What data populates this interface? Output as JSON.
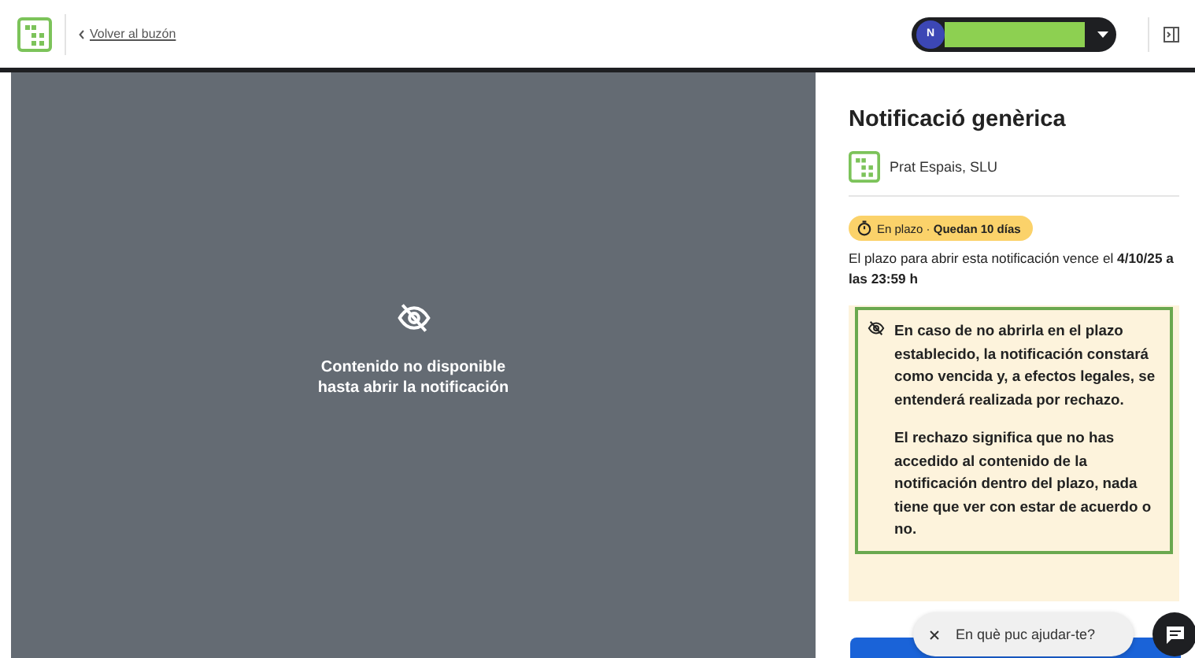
{
  "header": {
    "back_link": "Volver al buzón",
    "user": {
      "initial": "N"
    }
  },
  "viewer": {
    "message": "Contenido no disponible hasta abrir la notificación"
  },
  "panel": {
    "title": "Notificació genèrica",
    "sender": "Prat Espais, SLU",
    "status": {
      "label": "En plazo",
      "separator": "·",
      "detail": "Quedan 10 días"
    },
    "deadline": "El plazo para abrir esta notificación vence el **4/10/25 a las 23:59 h**",
    "warning": [
      "En caso de no abrirla en el plazo establecido, la notificación constará como vencida y, a efectos legales, se entenderá realizada por rechazo.",
      "El rechazo significa que no has accedido al contenido de la notificación dentro del plazo, nada tiene que ver con estar de acuerdo o no."
    ]
  },
  "chat": {
    "label": "En què puc ajudar-te?"
  }
}
